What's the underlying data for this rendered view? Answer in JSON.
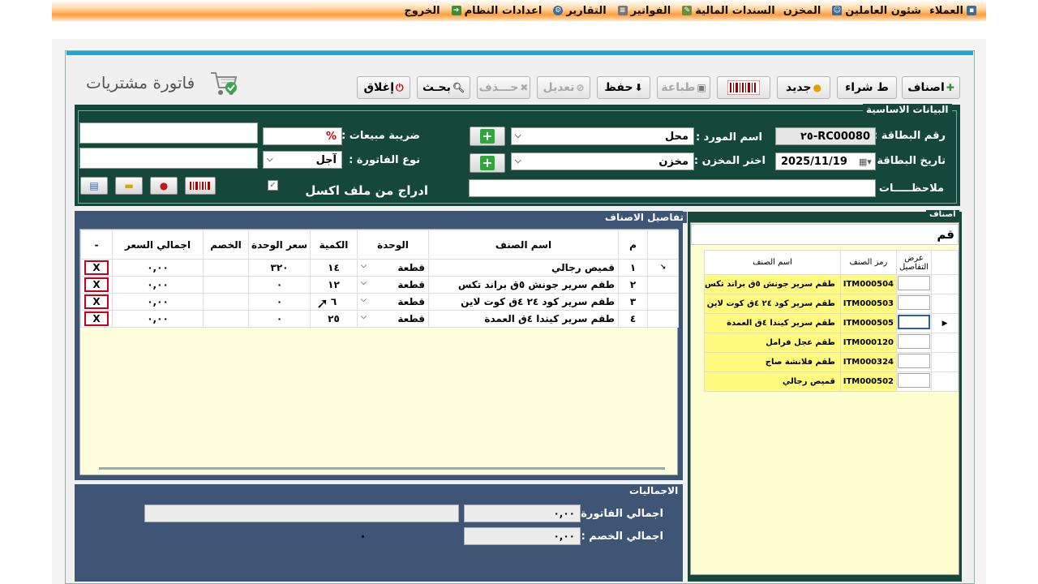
{
  "menu": [
    {
      "label": "العملاء",
      "icon": "users"
    },
    {
      "label": "شئون العاملين",
      "icon": "staff"
    },
    {
      "label": "المخزن",
      "icon": "warehouse"
    },
    {
      "label": "السندات المالية",
      "icon": "money"
    },
    {
      "label": "الفواتير",
      "icon": "invoice"
    },
    {
      "label": "التقارير",
      "icon": "report"
    },
    {
      "label": "اعدادات النظام",
      "icon": "settings"
    },
    {
      "label": "الخروج",
      "icon": "exit"
    }
  ],
  "page": {
    "title": "فاتورة مشتريات"
  },
  "toolbar": {
    "items": "اصناف",
    "purchase_request": "ط شراء",
    "new": "جديد",
    "print": "طباعة",
    "save": "حفظ",
    "edit": "تعديل",
    "delete": "حـــذف",
    "search": "بحـث",
    "close": "إغلاق"
  },
  "basic": {
    "legend": "البيانات الاساسية",
    "card_no_label": "رقم البطاقة :",
    "card_no": "RC00080-٢٥",
    "card_date_label": "تاريخ البطاقة :",
    "card_date": "2025/11/19",
    "notes_label": "ملاحظـــــات :",
    "notes": "",
    "supplier_label": "اسم المورد :",
    "supplier": "محل",
    "store_label": "اختر المخزن :",
    "store": "مخزن",
    "tax_label": "ضريبة مبيعات :",
    "tax": "%",
    "inv_type_label": "نوع الفاتورة :",
    "inv_type": "آجل",
    "excel_import": "ادراج من ملف اكسل"
  },
  "details": {
    "legend": "تفاصيل الاصناف",
    "columns": [
      "م",
      "اسم الصنف",
      "الوحدة",
      "الكمية",
      "سعر الوحدة",
      "الخصم",
      "اجمالي السعر",
      "-"
    ],
    "rows": [
      {
        "no": "١",
        "name": "قميص رجالي",
        "unit": "قطعة",
        "qty": "١٤",
        "price": "٣٢٠",
        "discount": "",
        "total": "٠,٠٠"
      },
      {
        "no": "٢",
        "name": "طقم سرير جونش ٥ق براند تكس",
        "unit": "قطعة",
        "qty": "١٢",
        "price": "٠",
        "discount": "",
        "total": "٠,٠٠"
      },
      {
        "no": "٣",
        "name": "طقم سرير كود ٢٤ ٤ق كوت لاين",
        "unit": "قطعة",
        "qty": "٦",
        "price": "٠",
        "discount": "",
        "total": "٠,٠٠"
      },
      {
        "no": "٤",
        "name": "طقم سرير كيندا ٤ق العمدة",
        "unit": "قطعة",
        "qty": "٢٥",
        "price": "٠",
        "discount": "",
        "total": "٠,٠٠"
      }
    ],
    "remove_label": "X"
  },
  "totals": {
    "legend": "الاجماليات",
    "invoice_total_label": "اجمالي الفاتورة :",
    "invoice_total": "٠,٠٠",
    "discount_total_label": "اجمالي الخصم :",
    "discount_total": "٠,٠٠"
  },
  "items_panel": {
    "legend": "اصناف",
    "search": "قم",
    "columns": [
      "عرض التفاصيل",
      "رمز الصنف",
      "اسم الصنف"
    ],
    "rows": [
      {
        "code": "ITM000504",
        "name": "طقم سرير جونش ٥ق براند تكس"
      },
      {
        "code": "ITM000503",
        "name": "طقم سرير كود ٢٤ ٤ق كوت لاين"
      },
      {
        "code": "ITM000505",
        "name": "طقم سرير كيندا ٤ق العمدة"
      },
      {
        "code": "ITM000120",
        "name": "طقم عجل فرامل"
      },
      {
        "code": "ITM000324",
        "name": "طقم فلانشة صاج"
      },
      {
        "code": "ITM000502",
        "name": "قميص رجالي"
      }
    ]
  }
}
